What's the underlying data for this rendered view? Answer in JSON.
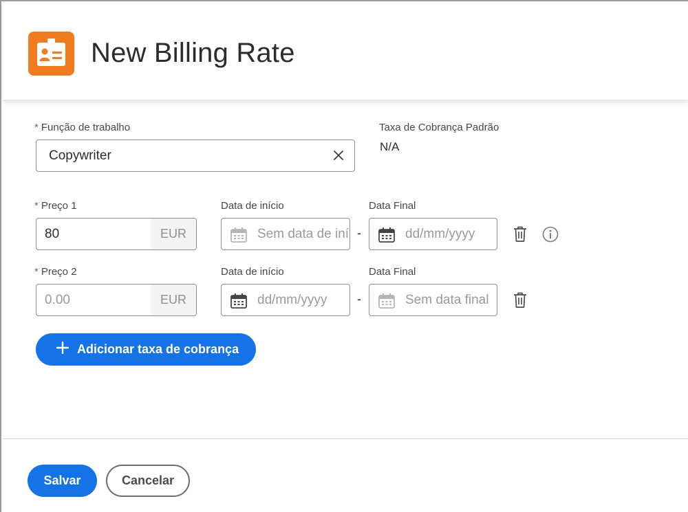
{
  "header": {
    "title": "New Billing Rate",
    "icon": "id-badge-icon",
    "icon_color": "#f07c1f"
  },
  "job_role": {
    "required_mark": "*",
    "label": "Função de trabalho",
    "value": "Copywriter"
  },
  "default_rate": {
    "label": "Taxa de Cobrança Padrão",
    "value": "N/A"
  },
  "rates": [
    {
      "required_mark": "*",
      "price_label": "Preço 1",
      "price_value": "80",
      "price_placeholder": "",
      "currency": "EUR",
      "start_label": "Data de início",
      "start_value": "",
      "start_placeholder": "Sem data de início",
      "separator": "-",
      "end_label": "Data Final",
      "end_value": "",
      "end_placeholder": "dd/mm/yyyy"
    },
    {
      "required_mark": "*",
      "price_label": "Preço 2",
      "price_value": "",
      "price_placeholder": "0.00",
      "currency": "EUR",
      "start_label": "Data de início",
      "start_value": "",
      "start_placeholder": "dd/mm/yyyy",
      "separator": "-",
      "end_label": "Data Final",
      "end_value": "",
      "end_placeholder": "Sem data final"
    }
  ],
  "actions": {
    "add_rate_label": "Adicionar taxa de cobrança",
    "save_label": "Salvar",
    "cancel_label": "Cancelar"
  },
  "colors": {
    "accent": "#1473e6",
    "brand_orange": "#f07c1f"
  }
}
